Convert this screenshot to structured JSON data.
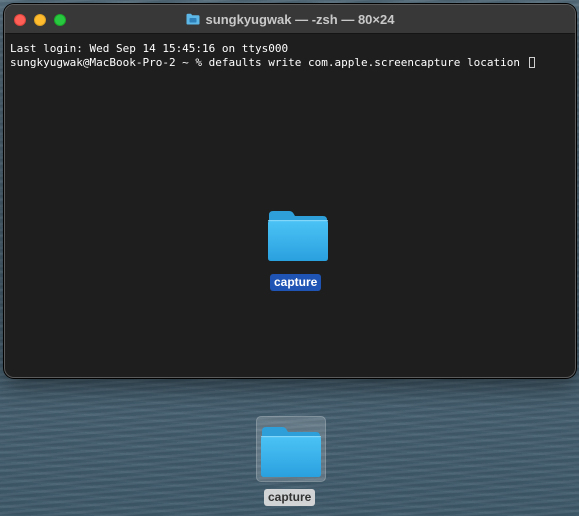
{
  "window": {
    "title": "sungkyugwak — -zsh — 80×24",
    "title_icon": "folder-icon"
  },
  "terminal": {
    "lines": [
      "Last login: Wed Sep 14 15:45:16 on ttys000",
      "sungkyugwak@MacBook-Pro-2 ~ % defaults write com.apple.screencapture location "
    ]
  },
  "dragged_item": {
    "label": "capture",
    "icon": "folder-icon"
  },
  "desktop_item": {
    "label": "capture",
    "icon": "folder-icon"
  },
  "colors": {
    "close": "#fe5f57",
    "minimize": "#febc2e",
    "maximize": "#28c840",
    "selection": "#1f54b4",
    "folder": "#3fb7f0"
  }
}
